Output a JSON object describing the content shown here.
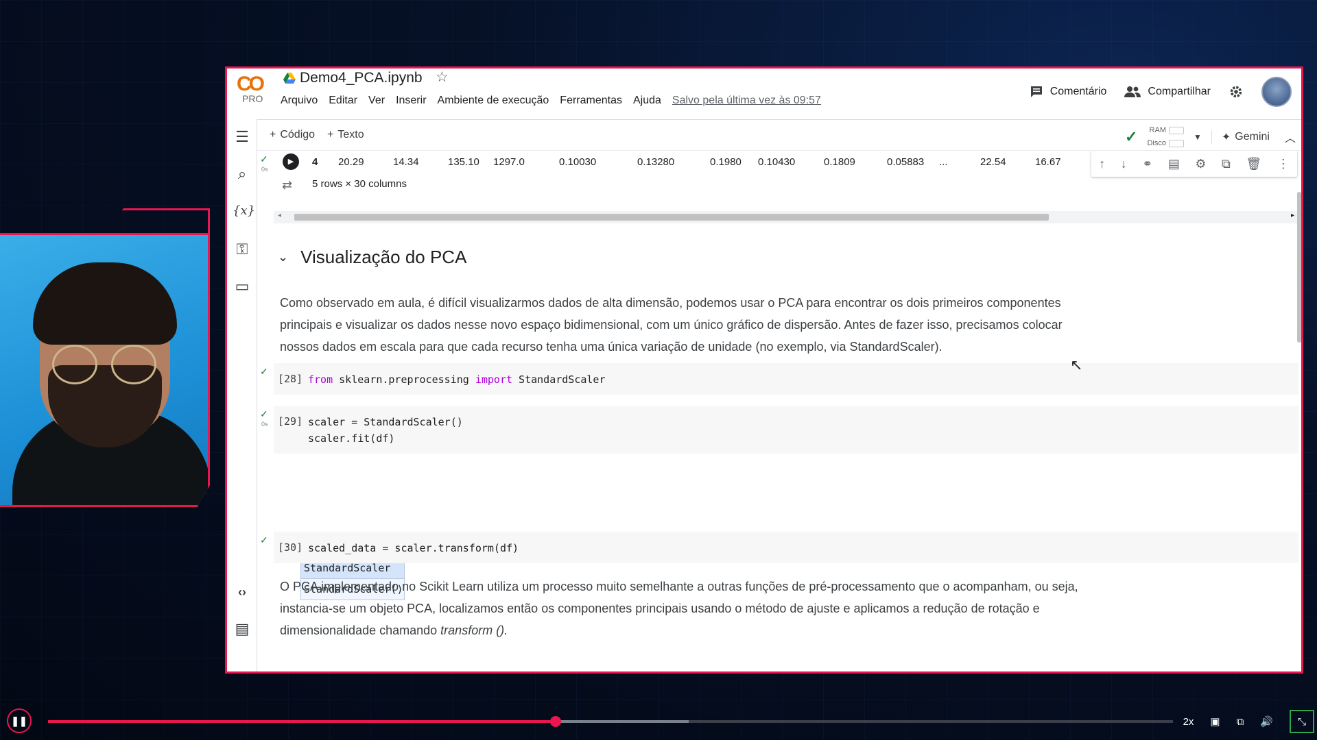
{
  "colab": {
    "logo": "CO",
    "pro_label": "PRO",
    "title": "Demo4_PCA.ipynb",
    "menus": [
      "Arquivo",
      "Editar",
      "Ver",
      "Inserir",
      "Ambiente de execução",
      "Ferramentas",
      "Ajuda"
    ],
    "saved_text": "Salvo pela última vez às 09:57",
    "comment_label": "Comentário",
    "share_label": "Compartilhar",
    "add_code_label": "Código",
    "add_text_label": "Texto",
    "ram_label": "RAM",
    "disk_label": "Disco",
    "gemini_label": "Gemini"
  },
  "table": {
    "row_index": "4",
    "row_values": [
      "20.29",
      "14.34",
      "135.10",
      "1297.0",
      "0.10030",
      "0.13280",
      "0.1980",
      "0.10430",
      "0.1809",
      "0.05883",
      "...",
      "22.54",
      "16.67"
    ],
    "row_info": "5 rows × 30 columns",
    "run_time": "0s"
  },
  "section": {
    "title": "Visualização do PCA",
    "paragraph1": "Como observado em aula, é difícil visualizarmos dados de alta dimensão, podemos usar o PCA para encontrar os dois primeiros componentes principais e visualizar os dados nesse novo espaço bidimensional, com um único gráfico de dispersão. Antes de fazer isso, precisamos colocar nossos dados em escala para que cada recurso tenha uma única variação de unidade (no exemplo, via StandardScaler).",
    "paragraph2_a": "O PCA implementado no Scikit Learn utiliza um processo muito semelhante a outras funções de pré-processamento que o acompanham, ou seja, instancia-se um objeto PCA, localizamos então os componentes principais usando o método de ajuste e aplicamos a redução de rotação e dimensionalidade chamando ",
    "paragraph2_italic": "transform ()."
  },
  "cells": {
    "c28": {
      "count": "[28]",
      "kw_from": "from",
      "module": " sklearn.preprocessing ",
      "kw_import": "import",
      "name": " StandardScaler"
    },
    "c29": {
      "count": "[29]",
      "line1": "scaler = StandardScaler()",
      "line2": "scaler.fit(df)",
      "time": "0s",
      "estimator_title": "▾ StandardScaler",
      "estimator_body": "StandardScaler()"
    },
    "c30": {
      "count": "[30]",
      "line1": "scaled_data = scaler.transform(df)"
    }
  },
  "player": {
    "speed": "2x",
    "progress_fraction": 0.451
  },
  "colors": {
    "accent": "#e8174e",
    "background": "#061127"
  }
}
